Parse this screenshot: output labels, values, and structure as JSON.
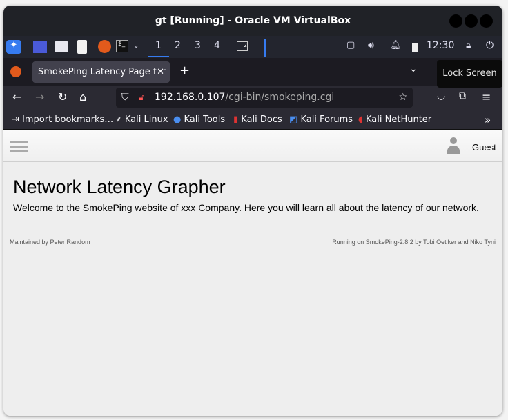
{
  "window": {
    "title": "gt [Running] - Oracle VM VirtualBox"
  },
  "taskbar": {
    "workspaces": [
      "1",
      "2",
      "3",
      "4"
    ],
    "active_workspace": "1",
    "window_badge": "2",
    "clock": "12:30"
  },
  "browser": {
    "tab_title": "SmokePing Latency Page for",
    "url_host": "192.168.0.107",
    "url_path": "/cgi-bin/smokeping.cgi",
    "tooltip": "Lock Screen",
    "bookmarks": [
      "Import bookmarks…",
      "Kali Linux",
      "Kali Tools",
      "Kali Docs",
      "Kali Forums",
      "Kali NetHunter"
    ]
  },
  "page": {
    "user": "Guest",
    "title": "Network Latency Grapher",
    "welcome": "Welcome to the SmokePing website of xxx Company. Here you will learn all about the latency of our network.",
    "footer_left": "Maintained by Peter Random",
    "footer_right": "Running on SmokePing-2.8.2 by Tobi Oetiker and Niko Tyni"
  },
  "colors": {
    "accent": "#367bf0",
    "titlebar": "#202227",
    "page_bg": "#eeeeee"
  }
}
